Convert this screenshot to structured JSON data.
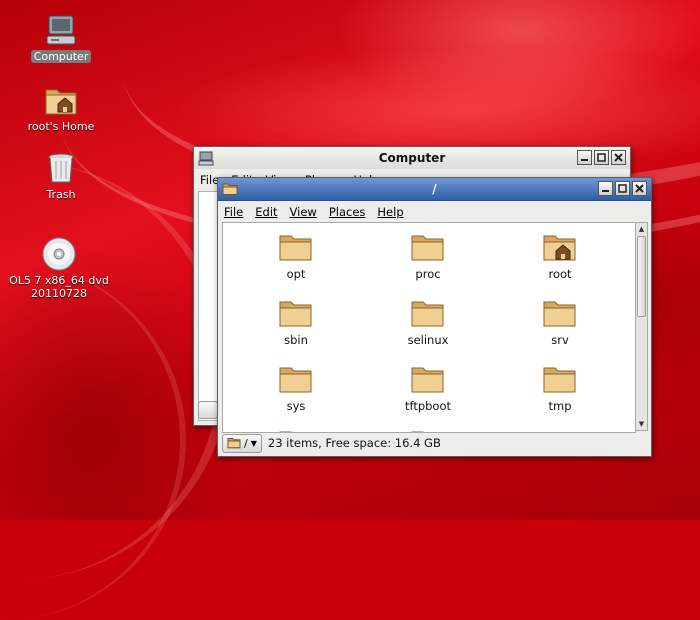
{
  "desktop": {
    "icons": [
      {
        "label": "Computer",
        "icon": "computer-icon",
        "selected": true
      },
      {
        "label": "root's Home",
        "icon": "home-folder-icon"
      },
      {
        "label": "Trash",
        "icon": "trash-icon"
      },
      {
        "label_line1": "OL5 7 x86_64 dvd",
        "label_line2": "20110728",
        "icon": "dvd-icon"
      }
    ]
  },
  "back_window": {
    "title": "Computer",
    "menu": [
      "File",
      "Edit",
      "View",
      "Places",
      "Help"
    ]
  },
  "front_window": {
    "title": "/",
    "menu": [
      "File",
      "Edit",
      "View",
      "Places",
      "Help"
    ],
    "folders": [
      {
        "name": "opt",
        "icon": "folder-icon"
      },
      {
        "name": "proc",
        "icon": "folder-icon"
      },
      {
        "name": "root",
        "icon": "home-folder-icon"
      },
      {
        "name": "sbin",
        "icon": "folder-icon"
      },
      {
        "name": "selinux",
        "icon": "folder-icon"
      },
      {
        "name": "srv",
        "icon": "folder-icon"
      },
      {
        "name": "sys",
        "icon": "folder-icon"
      },
      {
        "name": "tftpboot",
        "icon": "folder-icon"
      },
      {
        "name": "tmp",
        "icon": "folder-icon"
      }
    ],
    "status": {
      "path_label": "/",
      "text": "23 items, Free space: 16.4 GB"
    },
    "scroll_fraction": 0.45
  },
  "colors": {
    "desktop_red": "#c8000a",
    "active_title": "#2f5ea6",
    "folder_tan": "#e7c58d"
  }
}
